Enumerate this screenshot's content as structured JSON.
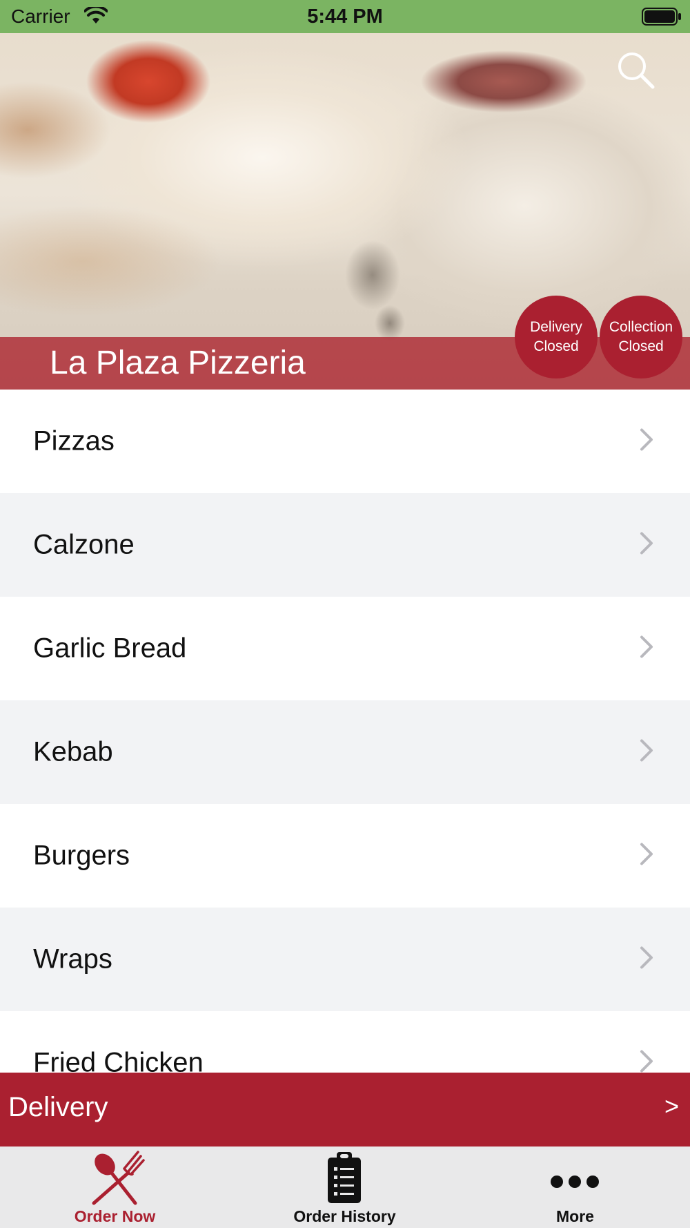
{
  "status_bar": {
    "carrier": "Carrier",
    "time": "5:44 PM",
    "icons": [
      "wifi-icon",
      "battery-icon"
    ]
  },
  "header": {
    "restaurant_name": "La Plaza Pizzeria",
    "search_icon": "search-icon",
    "badges": {
      "delivery": {
        "line1": "Delivery",
        "line2": "Closed"
      },
      "collection": {
        "line1": "Collection",
        "line2": "Closed"
      }
    }
  },
  "menu": {
    "categories": [
      {
        "label": "Pizzas"
      },
      {
        "label": "Calzone"
      },
      {
        "label": "Garlic Bread"
      },
      {
        "label": "Kebab"
      },
      {
        "label": "Burgers"
      },
      {
        "label": "Wraps"
      },
      {
        "label": "Fried Chicken"
      }
    ],
    "chevron_icon": "chevron-right-icon"
  },
  "delivery_bar": {
    "label": "Delivery",
    "arrow": ">"
  },
  "tab_bar": {
    "tabs": [
      {
        "label": "Order Now",
        "icon": "fork-knife-icon",
        "active": true
      },
      {
        "label": "Order History",
        "icon": "clipboard-icon",
        "active": false
      },
      {
        "label": "More",
        "icon": "more-dots-icon",
        "active": false
      }
    ]
  },
  "colors": {
    "accent": "#aa2030",
    "status_bar": "#7bb462",
    "row_alt": "#f2f3f5",
    "tab_bar": "#e9e9ea"
  }
}
